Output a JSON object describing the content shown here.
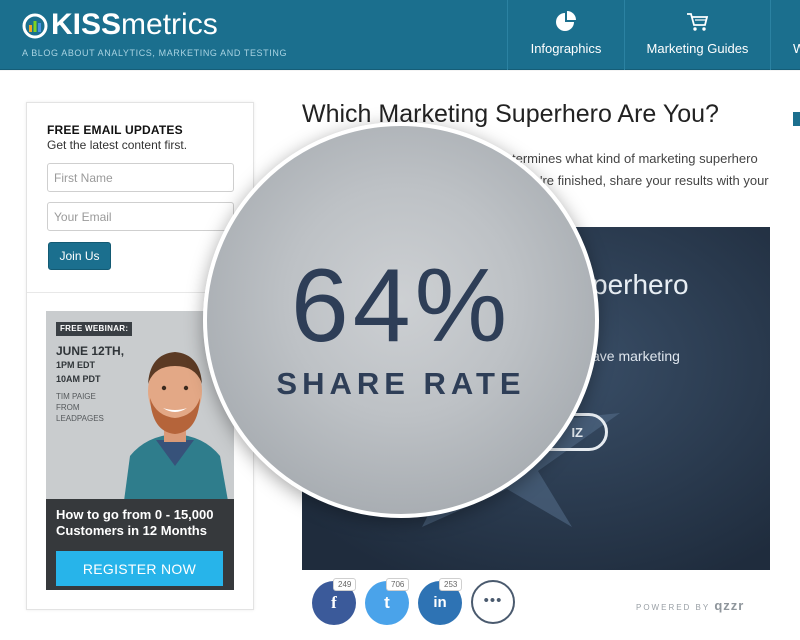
{
  "header": {
    "logo_bold": "KISS",
    "logo_light": "metrics",
    "tagline": "A BLOG ABOUT ANALYTICS, MARKETING AND TESTING",
    "nav": [
      {
        "label": "Infographics",
        "icon": "pie-chart-icon"
      },
      {
        "label": "Marketing Guides",
        "icon": "shopping-cart-icon"
      },
      {
        "label": "W",
        "icon": ""
      }
    ]
  },
  "sidebar": {
    "title": "FREE EMAIL UPDATES",
    "subtitle": "Get the latest content first.",
    "first_name_placeholder": "First Name",
    "email_placeholder": "Your Email",
    "join_label": "Join Us"
  },
  "webinar": {
    "badge": "FREE WEBINAR:",
    "date_line1": "JUNE 12TH,",
    "date_line2": "1PM EDT",
    "date_line3": "10AM PDT",
    "speaker_name": "TIM PAIGE",
    "speaker_from": "FROM",
    "speaker_company": "LEADPAGES",
    "headline": "How to go from 0 - 15,000 Customers in 12 Months",
    "register_label": "REGISTER NOW"
  },
  "article": {
    "title": "Which Marketing Superhero Are You?",
    "paragraph_line1": "termines what kind of marketing superhero",
    "paragraph_line2": "'re finished, share your results with your",
    "quiz_title": "perhero",
    "quiz_desc": "ave marketing",
    "quiz_button": "IZ"
  },
  "share": {
    "facebook_count": "249",
    "twitter_count": "706",
    "linkedin_count": "253",
    "facebook_glyph": "f",
    "twitter_glyph": "t",
    "linkedin_glyph": "in",
    "more_glyph": "•••",
    "powered_by": "POWERED BY",
    "powered_brand": "qzzr"
  },
  "stat": {
    "value": "64%",
    "label": "SHARE RATE"
  },
  "colors": {
    "header_bg": "#1b6f8e",
    "accent_button": "#1b6f8e",
    "register_button": "#27b4ea",
    "facebook": "#3b5a9a",
    "twitter": "#4aa3ea",
    "linkedin": "#2e73b4",
    "stat_text": "#2e3e57"
  }
}
